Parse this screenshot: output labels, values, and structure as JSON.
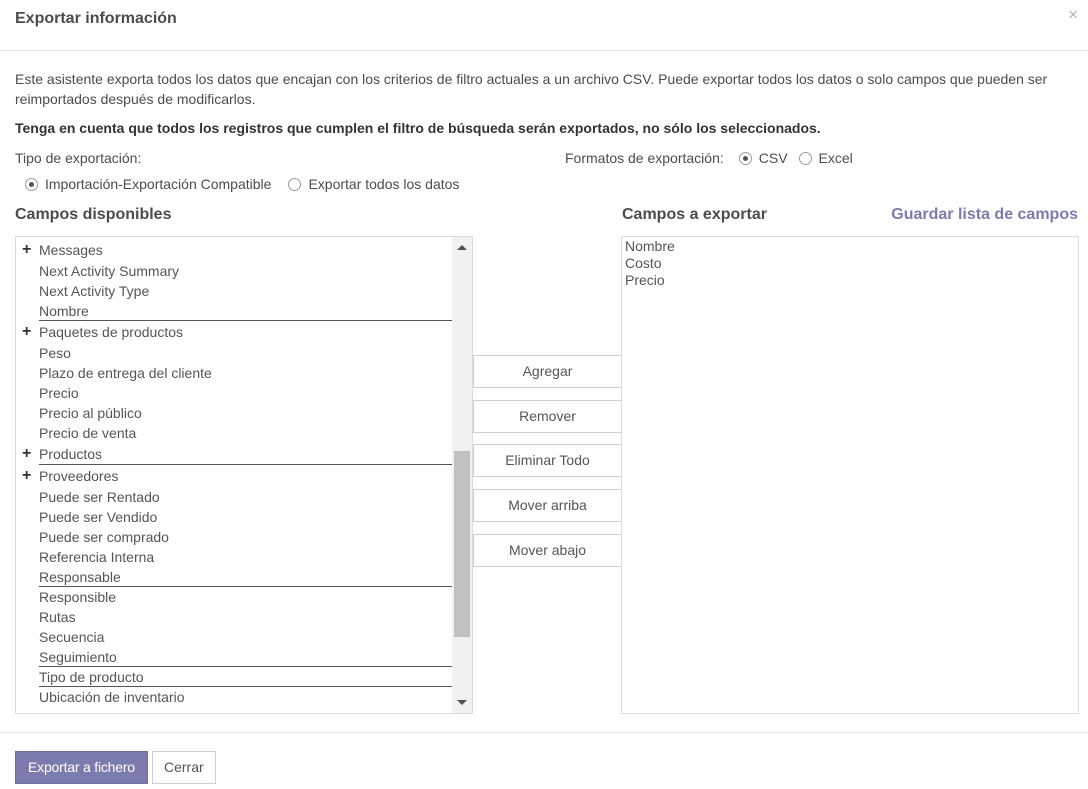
{
  "dialog": {
    "title": "Exportar información",
    "close_glyph": "×"
  },
  "intro": "Este asistente exporta todos los datos que encajan con los criterios de filtro actuales a un archivo CSV. Puede exportar todos los datos o solo campos que pueden ser reimportados después de modificarlos.",
  "warning": "Tenga en cuenta que todos los registros que cumplen el filtro de búsqueda serán exportados, no sólo los seleccionados.",
  "export_type": {
    "label": "Tipo de exportación:",
    "options": [
      {
        "label": "Importación-Exportación Compatible",
        "checked": true
      },
      {
        "label": "Exportar todos los datos",
        "checked": false
      }
    ]
  },
  "export_format": {
    "label": "Formatos de exportación:",
    "options": [
      {
        "label": "CSV",
        "checked": true
      },
      {
        "label": "Excel",
        "checked": false
      }
    ]
  },
  "available": {
    "title": "Campos disponibles",
    "items": [
      {
        "label": "Messages",
        "expandable": true
      },
      {
        "label": "Next Activity Summary"
      },
      {
        "label": "Next Activity Type"
      },
      {
        "label": "Nombre",
        "separator": true
      },
      {
        "label": "Paquetes de productos",
        "expandable": true
      },
      {
        "label": "Peso"
      },
      {
        "label": "Plazo de entrega del cliente"
      },
      {
        "label": "Precio"
      },
      {
        "label": "Precio al público"
      },
      {
        "label": "Precio de venta"
      },
      {
        "label": "Productos",
        "expandable": true,
        "separator": true
      },
      {
        "label": "Proveedores",
        "expandable": true
      },
      {
        "label": "Puede ser Rentado"
      },
      {
        "label": "Puede ser Vendido"
      },
      {
        "label": "Puede ser comprado"
      },
      {
        "label": "Referencia Interna"
      },
      {
        "label": "Responsable",
        "separator": true
      },
      {
        "label": "Responsible"
      },
      {
        "label": "Rutas"
      },
      {
        "label": "Secuencia"
      },
      {
        "label": "Seguimiento",
        "separator": true
      },
      {
        "label": "Tipo de producto",
        "separator": true
      },
      {
        "label": "Ubicación de inventario"
      }
    ]
  },
  "actions": {
    "add": "Agregar",
    "remove": "Remover",
    "remove_all": "Eliminar Todo",
    "move_up": "Mover arriba",
    "move_down": "Mover abajo"
  },
  "to_export": {
    "title": "Campos a exportar",
    "save_list": "Guardar lista de campos",
    "items": [
      "Nombre",
      "Costo",
      "Precio"
    ]
  },
  "footer": {
    "export": "Exportar a fichero",
    "close": "Cerrar"
  }
}
